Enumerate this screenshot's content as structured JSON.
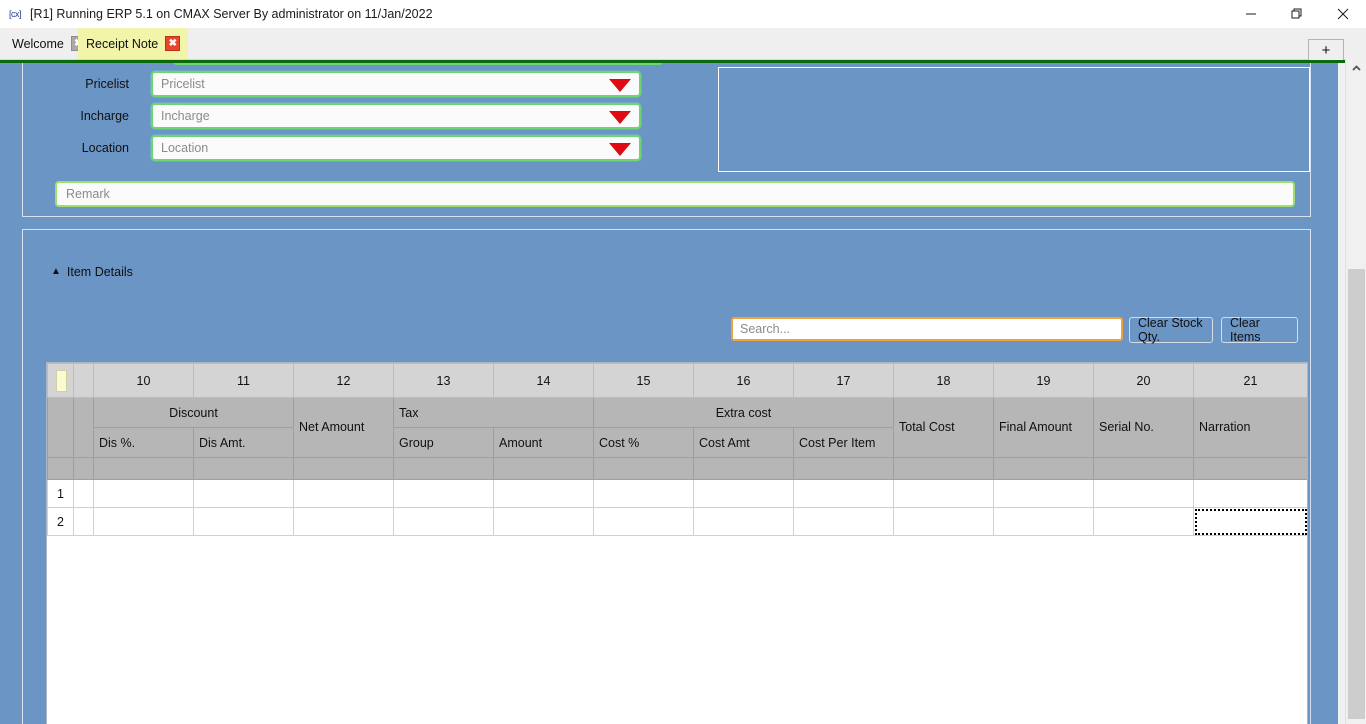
{
  "window": {
    "app_badge": "[cx]",
    "title": "[R1] Running ERP 5.1 on CMAX Server By administrator on 11/Jan/2022",
    "minimize_label": "minimize-icon",
    "restore_label": "restore-icon",
    "close_label": "close-icon"
  },
  "tabs": {
    "items": [
      {
        "label": "Welcome",
        "close": "✖",
        "active": false
      },
      {
        "label": "Receipt Note",
        "close": "✖",
        "active": true
      }
    ],
    "new_tab_label": "+"
  },
  "form": {
    "fields": [
      {
        "label": "Pricelist",
        "placeholder": "Pricelist",
        "value": ""
      },
      {
        "label": "Incharge",
        "placeholder": "Incharge",
        "value": ""
      },
      {
        "label": "Location",
        "placeholder": "Location",
        "value": ""
      }
    ],
    "remark": {
      "placeholder": "Remark",
      "value": ""
    }
  },
  "items_section": {
    "collapse_icon": "▲",
    "title": "Item Details",
    "search": {
      "placeholder": "Search...",
      "value": ""
    },
    "clear_stock_qty_label": "Clear Stock Qty.",
    "clear_items_label": "Clear Items"
  },
  "grid": {
    "column_numbers": [
      "10",
      "11",
      "12",
      "13",
      "14",
      "15",
      "16",
      "17",
      "18",
      "19",
      "20",
      "21"
    ],
    "group_headers": [
      {
        "label": "Discount",
        "span": 2,
        "align": "center"
      },
      {
        "label": "Net Amount",
        "span": 1,
        "rowspan": true,
        "align": "left"
      },
      {
        "label": "Tax",
        "span": 2,
        "align": "left"
      },
      {
        "label": "Extra cost",
        "span": 3,
        "align": "center"
      },
      {
        "label": "",
        "span": 0,
        "align": "left"
      },
      {
        "label": "Total Cost",
        "span": 1,
        "rowspan": true,
        "align": "left"
      },
      {
        "label": "Final Amount",
        "span": 1,
        "rowspan": true,
        "align": "left"
      },
      {
        "label": "Serial No.",
        "span": 1,
        "rowspan": true,
        "align": "left"
      },
      {
        "label": "Narration",
        "span": 1,
        "rowspan": true,
        "align": "left"
      }
    ],
    "sub_headers": [
      "Dis %.",
      "Dis Amt.",
      "Group",
      "Amount",
      "Cost %",
      "Cost Amt",
      "Cost Per Item"
    ],
    "rows": [
      {
        "number": "1",
        "cells": [
          "",
          "",
          "",
          "",
          "",
          "",
          "",
          "",
          "",
          "",
          "",
          ""
        ]
      },
      {
        "number": "2",
        "cells": [
          "",
          "",
          "",
          "",
          "",
          "",
          "",
          "",
          "",
          "",
          "",
          ""
        ]
      }
    ],
    "selected_row": "2",
    "selected_column": "21"
  },
  "colors": {
    "workspace_blue": "#6b95c4",
    "green_bar": "#0a6b0a",
    "field_border_green": "#6fd66f",
    "search_border_orange": "#f0a03c",
    "active_tab_yellow": "#f2f5a9",
    "close_red": "#e8452c",
    "caret_red": "#dd0b12",
    "header_gray": "#d4d4d4",
    "subheader_gray": "#b6b6b6"
  }
}
